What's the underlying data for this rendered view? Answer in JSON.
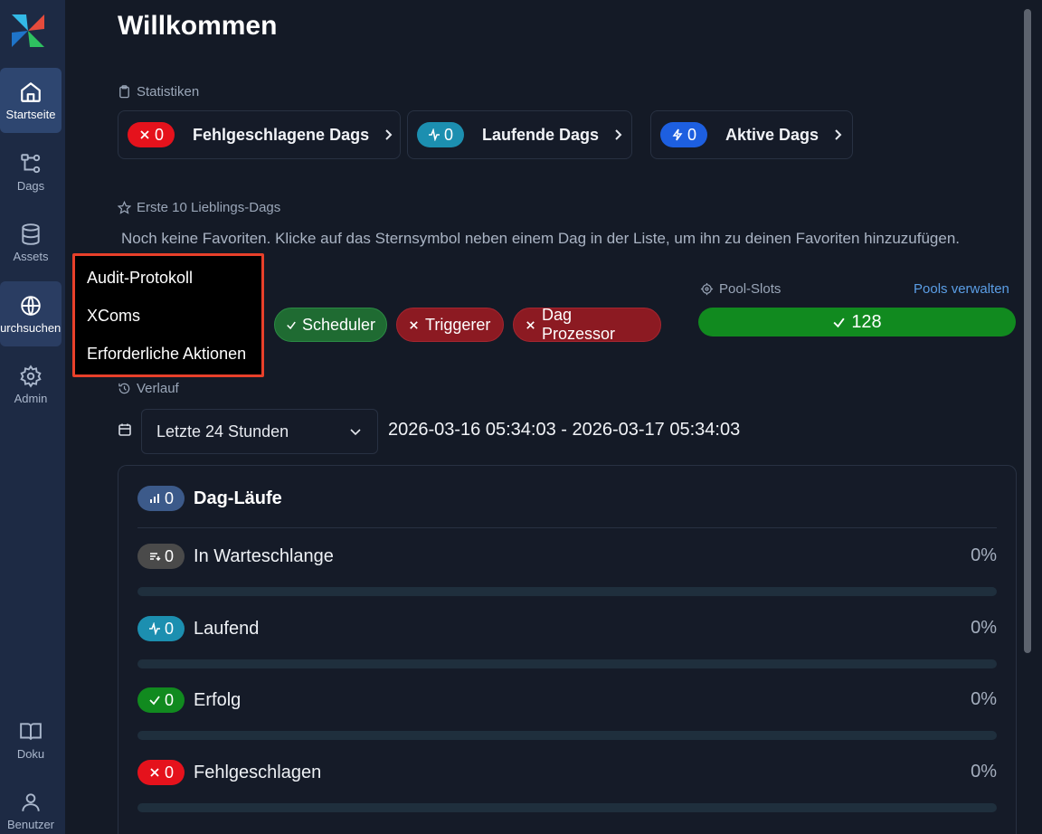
{
  "sidebar": {
    "items": [
      {
        "label": "Startseite",
        "icon": "home-icon"
      },
      {
        "label": "Dags",
        "icon": "dags-icon"
      },
      {
        "label": "Assets",
        "icon": "database-icon"
      },
      {
        "label": "Durchsuchen",
        "icon": "globe-icon"
      },
      {
        "label": "Admin",
        "icon": "gear-icon"
      },
      {
        "label": "Doku",
        "icon": "book-icon"
      },
      {
        "label": "Benutzer",
        "icon": "user-icon"
      }
    ]
  },
  "main": {
    "title": "Willkommen",
    "stats": {
      "label": "Statistiken",
      "cards": [
        {
          "count": "0",
          "label": "Fehlgeschlagene Dags",
          "color": "#e5121c"
        },
        {
          "count": "0",
          "label": "Laufende Dags",
          "color": "#1c8fb0"
        },
        {
          "count": "0",
          "label": "Aktive Dags",
          "color": "#1d5fe0"
        }
      ]
    },
    "favorites": {
      "label": "Erste 10 Lieblings-Dags",
      "empty_text": "Noch keine Favoriten. Klicke auf das Sternsymbol neben einem Dag in der Liste, um ihn zu deinen Favoriten hinzuzufügen."
    },
    "health": {
      "scheduler": "Scheduler",
      "triggerer": "Triggerer",
      "dag_processor": "Dag Prozessor"
    },
    "pools": {
      "label": "Pool-Slots",
      "manage_link": "Pools verwalten",
      "value": "128"
    },
    "history": {
      "label": "Verlauf",
      "range_select": "Letzte 24 Stunden",
      "range_text": "2026-03-16 05:34:03 - 2026-03-17 05:34:03"
    },
    "dag_runs": {
      "title": "Dag-Läufe",
      "count": "0",
      "rows": [
        {
          "label": "In Warteschlange",
          "count": "0",
          "percent": "0%",
          "color": "#4a4a4a",
          "progress": 0
        },
        {
          "label": "Laufend",
          "count": "0",
          "percent": "0%",
          "color": "#1c8fb0",
          "progress": 0
        },
        {
          "label": "Erfolg",
          "count": "0",
          "percent": "0%",
          "color": "#118a1f",
          "progress": 0
        },
        {
          "label": "Fehlgeschlagen",
          "count": "0",
          "percent": "0%",
          "color": "#e5121c",
          "progress": 0
        }
      ]
    }
  },
  "menu": {
    "items": [
      "Audit-Protokoll",
      "XComs",
      "Erforderliche Aktionen"
    ]
  },
  "colors": {
    "accent": "#2e4670",
    "menu_border": "#e8402a",
    "runs_badge": "#3c5a8a"
  }
}
